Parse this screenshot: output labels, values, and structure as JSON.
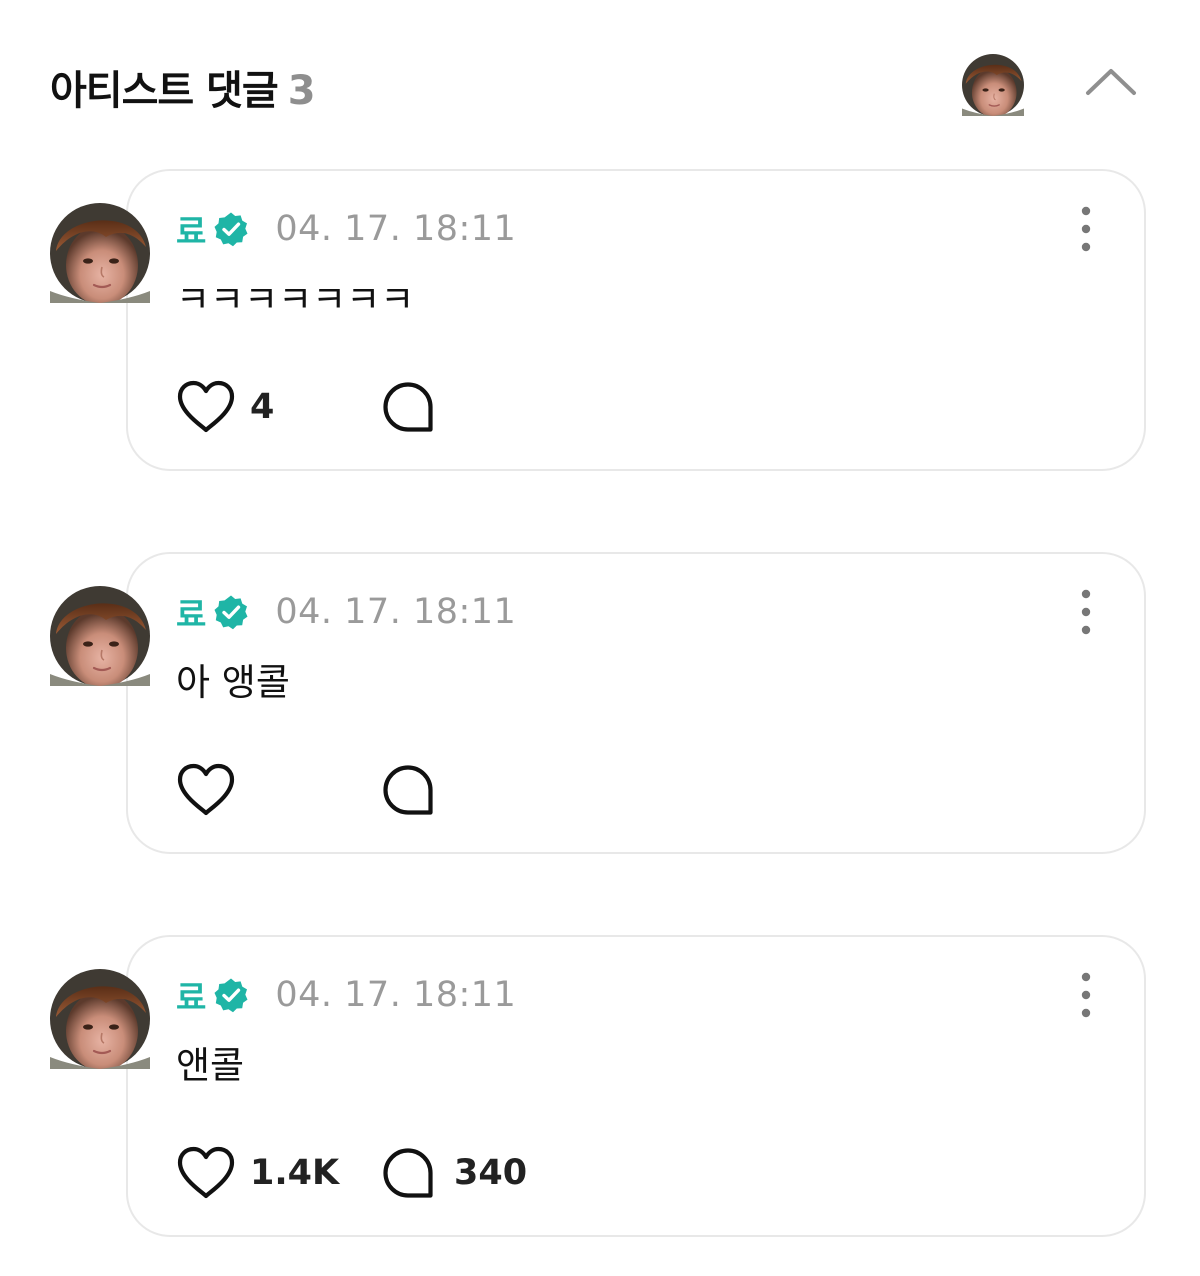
{
  "header": {
    "title": "아티스트 댓글",
    "count": "3",
    "avatar_icon": "artist-avatar",
    "collapse_icon": "chevron-up-icon"
  },
  "colors": {
    "accent": "#1fb5a6",
    "timestamp": "#9a9a9a",
    "card_border": "#e8e8e8"
  },
  "comments": [
    {
      "author": "료",
      "verified": true,
      "timestamp": "04. 17. 18:11",
      "text": "ㅋㅋㅋㅋㅋㅋㅋ",
      "likes": "4",
      "replies": ""
    },
    {
      "author": "료",
      "verified": true,
      "timestamp": "04. 17. 18:11",
      "text": "아 앵콜",
      "likes": "",
      "replies": ""
    },
    {
      "author": "료",
      "verified": true,
      "timestamp": "04. 17. 18:11",
      "text": "앤콜",
      "likes": "1.4K",
      "replies": "340"
    }
  ]
}
